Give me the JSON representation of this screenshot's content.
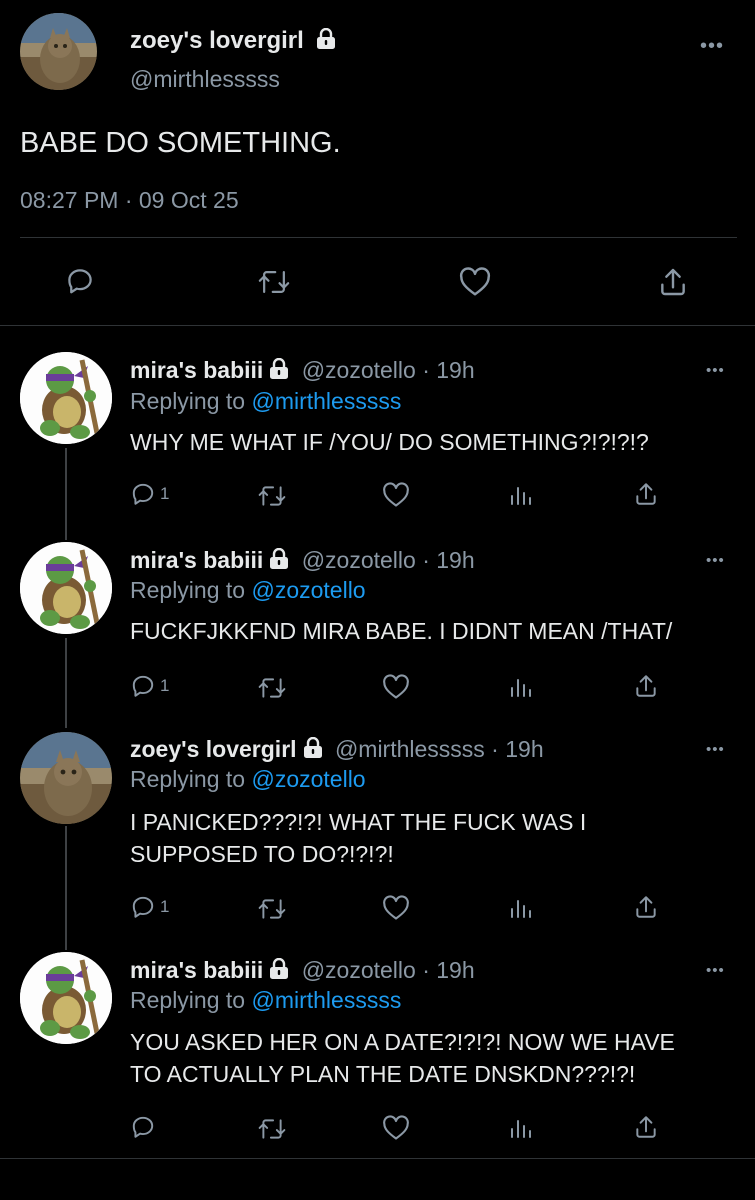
{
  "main_tweet": {
    "display_name": "zoey's lovergirl",
    "handle": "@mirthlesssss",
    "text": "BABE DO SOMETHING.",
    "timestamp": "08:27 PM · 09 Oct 25",
    "more_label": "•••"
  },
  "replies": [
    {
      "display_name": "mira's babiii",
      "handle": "@zozotello · 19h",
      "replying_prefix": "Replying to ",
      "replying_to": "@mirthlesssss",
      "text": "WHY ME WHAT IF /YOU/ DO SOMETHING?!?!?!?",
      "reply_count": "1",
      "more_label": "•••"
    },
    {
      "display_name": "mira's babiii",
      "handle": "@zozotello · 19h",
      "replying_prefix": "Replying to ",
      "replying_to": "@zozotello",
      "text": "FUCKFJKKFND MIRA BABE. I DIDNT MEAN /THAT/",
      "reply_count": "1",
      "more_label": "•••"
    },
    {
      "display_name": "zoey's lovergirl",
      "handle": "@mirthlesssss · 19h",
      "replying_prefix": "Replying to ",
      "replying_to": "@zozotello",
      "text_line1": "I PANICKED???!?! WHAT THE FUCK WAS I",
      "text_line2": "SUPPOSED TO DO?!?!?!",
      "reply_count": "1",
      "more_label": "•••"
    },
    {
      "display_name": "mira's babiii",
      "handle": "@zozotello · 19h",
      "replying_prefix": "Replying to ",
      "replying_to": "@mirthlesssss",
      "text_line1": "YOU ASKED HER ON A DATE?!?!?! NOW WE HAVE",
      "text_line2": "TO ACTUALLY PLAN THE DATE DNSKDN???!?!",
      "reply_count": "",
      "more_label": "•••"
    }
  ],
  "icons": {
    "reply": "reply-icon",
    "retweet": "retweet-icon",
    "like": "heart-icon",
    "views": "views-icon",
    "share": "share-icon",
    "lock": "lock-icon"
  },
  "colors": {
    "background": "#000000",
    "text": "#e7e9ea",
    "secondary": "#8b98a5",
    "link": "#1d9bf0",
    "divider": "#2f3336"
  }
}
